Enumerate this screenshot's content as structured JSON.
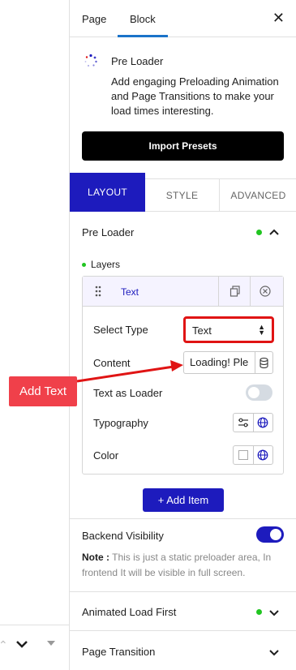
{
  "top_tabs": {
    "page": "Page",
    "block": "Block"
  },
  "block": {
    "title": "Pre Loader",
    "description": "Add engaging Preloading Animation and Page Transitions to make your load times interesting.",
    "import_label": "Import Presets"
  },
  "panel_tabs": {
    "layout": "LAYOUT",
    "style": "STYLE",
    "advanced": "ADVANCED"
  },
  "sections": {
    "pre_loader": "Pre Loader",
    "layers": "Layers",
    "backend_visibility": "Backend Visibility",
    "animated_load_first": "Animated Load First",
    "page_transition": "Page Transition"
  },
  "layer": {
    "title": "Text",
    "select_type_label": "Select Type",
    "select_type_value": "Text",
    "content_label": "Content",
    "content_value": "Loading! Ple",
    "text_as_loader_label": "Text as Loader",
    "typography_label": "Typography",
    "color_label": "Color"
  },
  "add_item_label": "+ Add Item",
  "note": {
    "prefix": "Note :",
    "text": " This is just a static preloader area, In frontend It will be visible in full screen."
  },
  "toggles": {
    "text_as_loader": false,
    "backend_visibility": true
  },
  "annotation": {
    "label": "Add Text"
  },
  "colors": {
    "accent": "#1d1bbd",
    "status_green": "#21c521",
    "annotation_red": "#f0404a",
    "highlight_border": "#e01414"
  }
}
